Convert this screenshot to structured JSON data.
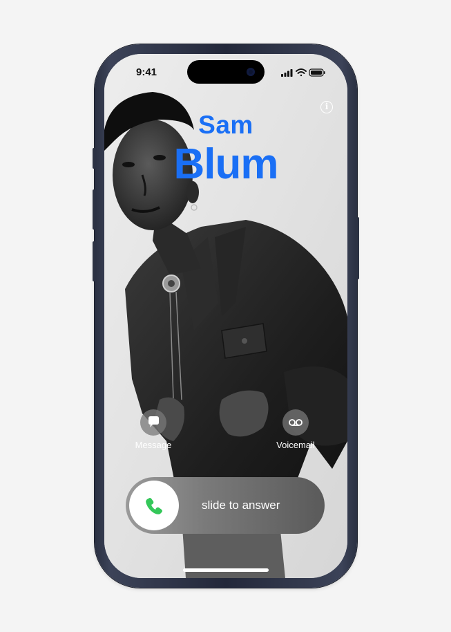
{
  "status_bar": {
    "time": "9:41"
  },
  "caller": {
    "first_name": "Sam",
    "last_name": "Blum"
  },
  "actions": {
    "message": {
      "label": "Message",
      "icon": "message-bubble-icon"
    },
    "voicemail": {
      "label": "Voicemail",
      "icon": "voicemail-icon"
    }
  },
  "answer_slider": {
    "label": "slide to answer",
    "icon": "phone-icon",
    "icon_color": "#34c759"
  },
  "colors": {
    "name_accent": "#1a6ff5",
    "phone_frame": "#2a3042"
  }
}
